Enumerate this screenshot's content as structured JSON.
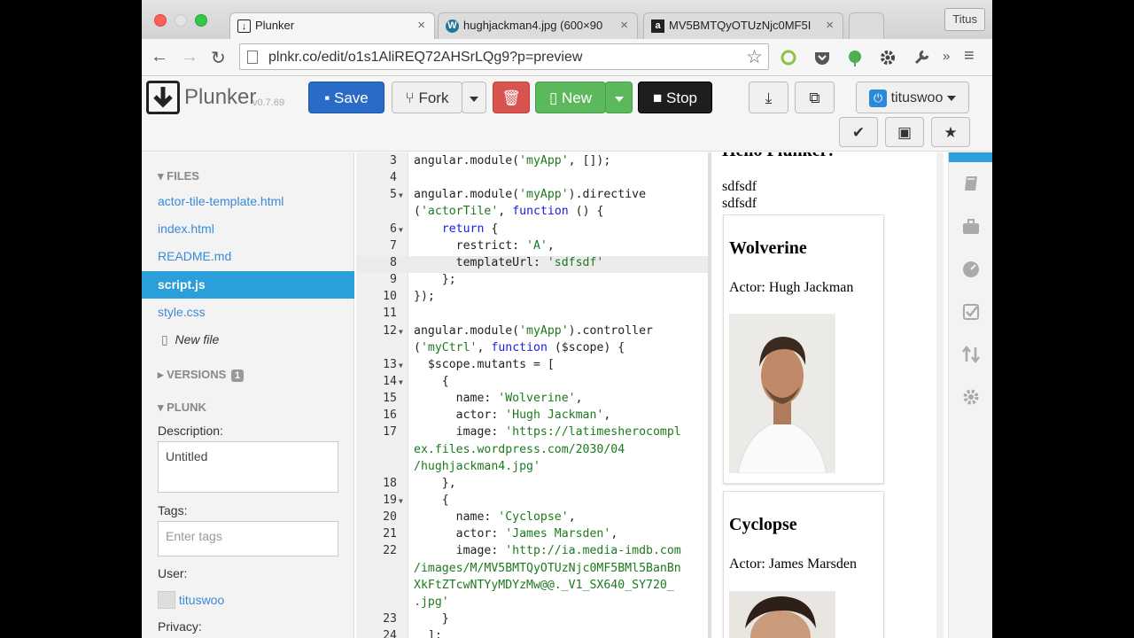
{
  "browser": {
    "tabs": [
      {
        "title": "Plunker",
        "active": true
      },
      {
        "title": "hughjackman4.jpg (600×90",
        "active": false
      },
      {
        "title": "MV5BMTQyOTUzNjc0MF5I",
        "active": false
      }
    ],
    "profile": "Titus",
    "url": "plnkr.co/edit/o1s1AliREQ72AHSrLQg9?p=preview"
  },
  "toolbar": {
    "logo_name": "Plunker",
    "version": "v0.7.69",
    "save": "Save",
    "fork": "Fork",
    "new": "New",
    "stop": "Stop",
    "user": "tituswoo"
  },
  "sidebar": {
    "files_heading": "FILES",
    "files": [
      {
        "name": "actor-tile-template.html",
        "active": false
      },
      {
        "name": "index.html",
        "active": false
      },
      {
        "name": "README.md",
        "active": false
      },
      {
        "name": "script.js",
        "active": true
      },
      {
        "name": "style.css",
        "active": false
      }
    ],
    "new_file": "New file",
    "versions_heading": "VERSIONS",
    "versions_count": "1",
    "plunk_heading": "PLUNK",
    "description_label": "Description:",
    "description_value": "Untitled",
    "tags_label": "Tags:",
    "tags_placeholder": "Enter tags",
    "user_label": "User:",
    "user_name": "tituswoo",
    "privacy_label": "Privacy:"
  },
  "editor": {
    "lines": [
      {
        "n": "3",
        "fold": false,
        "html": "angular.module(<span class='str'>'myApp'</span>, []);"
      },
      {
        "n": "4",
        "fold": false,
        "html": ""
      },
      {
        "n": "5",
        "fold": true,
        "html": "angular.module(<span class='str'>'myApp'</span>).directive"
      },
      {
        "n": "",
        "fold": false,
        "html": "(<span class='str'>'actorTile'</span>, <span class='kw'>function</span> () {"
      },
      {
        "n": "6",
        "fold": true,
        "html": "    <span class='kw'>return</span> {"
      },
      {
        "n": "7",
        "fold": false,
        "html": "      restrict: <span class='str'>'A'</span>,"
      },
      {
        "n": "8",
        "fold": false,
        "html": "      templateUrl: <span class='str'>'sdfsdf'</span>",
        "hl": true
      },
      {
        "n": "9",
        "fold": false,
        "html": "    };"
      },
      {
        "n": "10",
        "fold": false,
        "html": "});"
      },
      {
        "n": "11",
        "fold": false,
        "html": ""
      },
      {
        "n": "12",
        "fold": true,
        "html": "angular.module(<span class='str'>'myApp'</span>).controller"
      },
      {
        "n": "",
        "fold": false,
        "html": "(<span class='str'>'myCtrl'</span>, <span class='kw'>function</span> ($scope) {"
      },
      {
        "n": "13",
        "fold": true,
        "html": "  $scope.mutants = ["
      },
      {
        "n": "14",
        "fold": true,
        "html": "    {"
      },
      {
        "n": "15",
        "fold": false,
        "html": "      name: <span class='str'>'Wolverine'</span>,"
      },
      {
        "n": "16",
        "fold": false,
        "html": "      actor: <span class='str'>'Hugh Jackman'</span>,"
      },
      {
        "n": "17",
        "fold": false,
        "html": "      image: <span class='str'>'https://latimesherocompl</span>"
      },
      {
        "n": "",
        "fold": false,
        "html": "<span class='str'>ex.files.wordpress.com/2030/04</span>"
      },
      {
        "n": "",
        "fold": false,
        "html": "<span class='str'>/hughjackman4.jpg'</span>"
      },
      {
        "n": "18",
        "fold": false,
        "html": "    },"
      },
      {
        "n": "19",
        "fold": true,
        "html": "    {"
      },
      {
        "n": "20",
        "fold": false,
        "html": "      name: <span class='str'>'Cyclopse'</span>,"
      },
      {
        "n": "21",
        "fold": false,
        "html": "      actor: <span class='str'>'James Marsden'</span>,"
      },
      {
        "n": "22",
        "fold": false,
        "html": "      image: <span class='str'>'http://ia.media-imdb.com</span>"
      },
      {
        "n": "",
        "fold": false,
        "html": "<span class='str'>/images/M/MV5BMTQyOTUzNjc0MF5BMl5BanBn</span>"
      },
      {
        "n": "",
        "fold": false,
        "html": "<span class='str'>XkFtZTcwNTYyMDYzMw@@._V1_SX640_SY720_</span>"
      },
      {
        "n": "",
        "fold": false,
        "html": "<span class='str'>.jpg'</span>"
      },
      {
        "n": "23",
        "fold": false,
        "html": "    }"
      },
      {
        "n": "24",
        "fold": false,
        "html": "  ];"
      }
    ]
  },
  "preview": {
    "heading": "Hello Plunker!",
    "line1": "sdfsdf",
    "line2": "sdfsdf",
    "cards": [
      {
        "name": "Wolverine",
        "actor": "Actor: Hugh Jackman"
      },
      {
        "name": "Cyclopse",
        "actor": "Actor: James Marsden"
      }
    ]
  },
  "colors": {
    "accent": "#2b9fd9",
    "save": "#2a6bc7",
    "new": "#5cb85c",
    "delete": "#d9534f",
    "stop": "#1e1e1e"
  }
}
